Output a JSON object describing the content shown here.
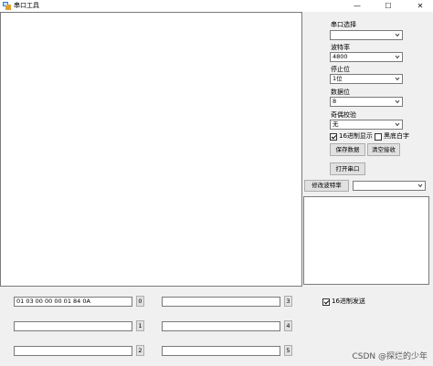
{
  "window": {
    "title": "串口工具",
    "minimize_glyph": "—",
    "maximize_glyph": "☐",
    "close_glyph": "✕"
  },
  "serial": {
    "port_label": "串口选择",
    "port_value": "",
    "baud_label": "波特率",
    "baud_value": "4800",
    "stop_label": "停止位",
    "stop_value": "1位",
    "data_label": "数据位",
    "data_value": "8",
    "parity_label": "奇偶校验",
    "parity_value": "无",
    "hex_display_label": "16进制显示",
    "hex_display_checked": true,
    "black_bg_label": "黑底白字",
    "black_bg_checked": false,
    "save_button": "保存数据",
    "clear_button": "清空接收",
    "open_button": "打开串口",
    "modify_baud_button": "修改波特率",
    "modify_baud_value": ""
  },
  "send": {
    "rows": [
      {
        "value": "01 03 00 00 00 01 84 0A",
        "button": "0"
      },
      {
        "value": "",
        "button": "1"
      },
      {
        "value": "",
        "button": "2"
      },
      {
        "value": "",
        "button": "3"
      },
      {
        "value": "",
        "button": "4"
      },
      {
        "value": "",
        "button": "5"
      }
    ],
    "hex_send_label": "16进制发送",
    "hex_send_checked": true
  },
  "watermark": "CSDN @探烂的少年"
}
